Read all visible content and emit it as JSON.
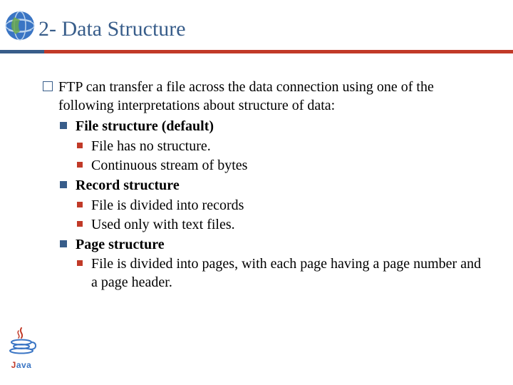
{
  "title": "2- Data Structure",
  "intro": "FTP can transfer a file across the data connection using one of the following interpretations about structure of data:",
  "items": [
    {
      "label": "File structure (default)",
      "sub": [
        "File has no structure.",
        "Continuous stream of bytes"
      ]
    },
    {
      "label": "Record structure",
      "sub": [
        "File is divided into records",
        "Used only with text files."
      ]
    },
    {
      "label": "Page structure",
      "sub": [
        "File is divided into pages, with each page having a page number and a page header."
      ]
    }
  ],
  "logo": {
    "j": "J",
    "ava": "ava"
  },
  "colors": {
    "accent": "#385d8a",
    "rule": "#c13a28"
  }
}
